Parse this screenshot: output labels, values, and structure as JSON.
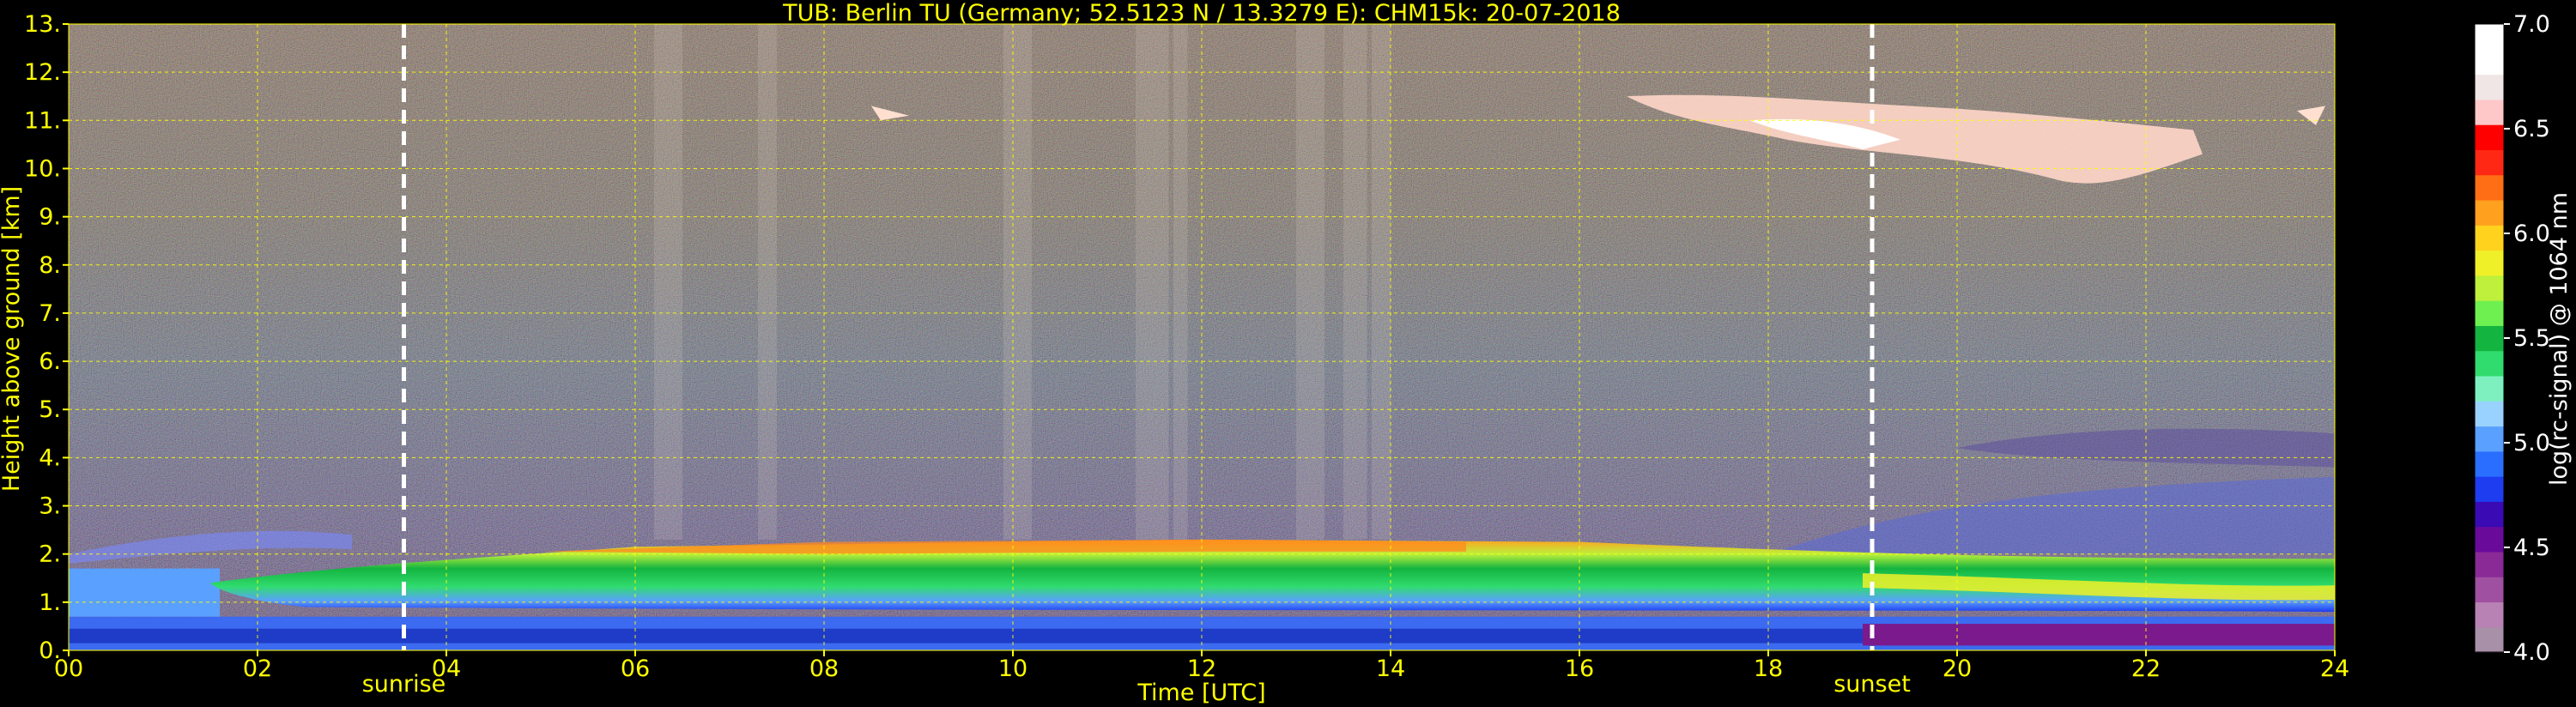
{
  "chart_data": {
    "type": "heatmap",
    "title": "TUB: Berlin TU (Germany; 52.5123 N / 13.3279 E):    CHM15k: 20-07-2018",
    "xlabel": "Time [UTC]",
    "ylabel": "Height above ground [km]",
    "xlim": [
      0,
      24
    ],
    "ylim": [
      0,
      13
    ],
    "xticks": [
      "00",
      "02",
      "04",
      "06",
      "08",
      "10",
      "12",
      "14",
      "16",
      "18",
      "20",
      "22",
      "24"
    ],
    "yticks": [
      "0.",
      "1.",
      "2.",
      "3.",
      "4.",
      "5.",
      "6.",
      "7.",
      "8.",
      "9.",
      "10.",
      "11.",
      "12.",
      "13."
    ],
    "grid": true,
    "events": [
      {
        "label": "sunrise",
        "time": 3.55
      },
      {
        "label": "sunset",
        "time": 19.1
      }
    ],
    "colorbar": {
      "label": "log(rc-signal) @ 1064 nm",
      "min": 4.0,
      "max": 7.0,
      "ticks": [
        "4.0",
        "4.5",
        "5.0",
        "5.5",
        "6.0",
        "6.5",
        "7.0"
      ],
      "colors": [
        "#a890a8",
        "#b882b4",
        "#a050a0",
        "#8a2a96",
        "#6a0a9a",
        "#3a0ab4",
        "#1e3cf0",
        "#2a6eff",
        "#5aa0ff",
        "#9ad2ff",
        "#7ef0c0",
        "#30dc6e",
        "#14b440",
        "#6ef050",
        "#bef03c",
        "#f0f028",
        "#ffd21e",
        "#ffa01e",
        "#ff6e14",
        "#ff2814",
        "#ff0000",
        "#ffc8c8",
        "#f0e6e6",
        "#ffffff",
        "#ffffff"
      ]
    },
    "layers": [
      {
        "name": "boundary layer aerosol",
        "start": 1.5,
        "end": 24,
        "bottom_km": 0.8,
        "top_km": 2.3
      },
      {
        "name": "cirrus cloud",
        "start": 16.5,
        "end": 24,
        "bottom_km": 9.5,
        "top_km": 11.6
      },
      {
        "name": "residual layer",
        "start": 18,
        "end": 24,
        "bottom_km": 2.0,
        "top_km": 3.6
      }
    ]
  }
}
